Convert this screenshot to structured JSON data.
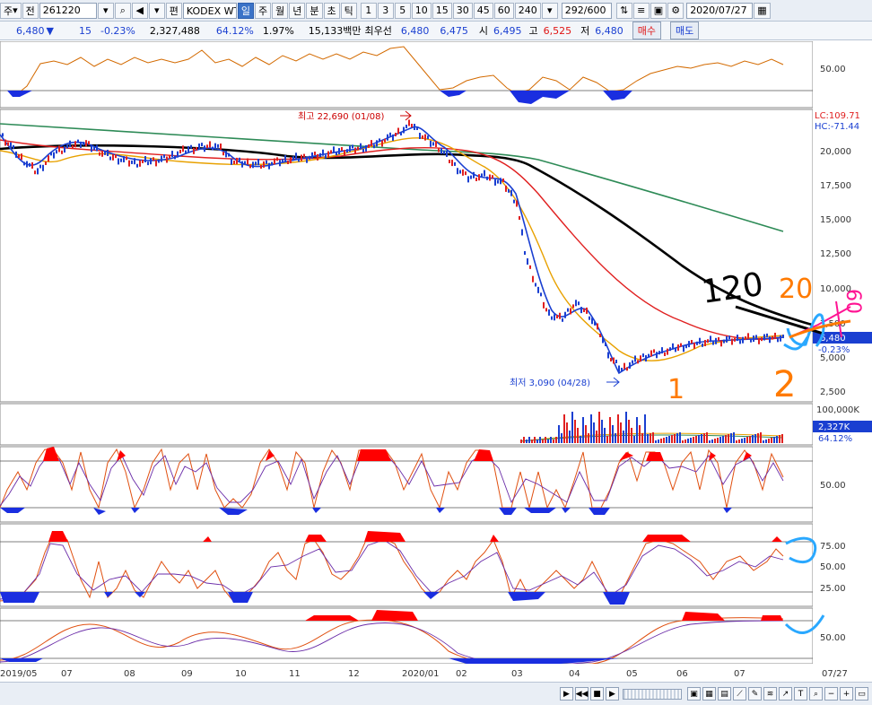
{
  "toolbar": {
    "market": "주",
    "type_label": "전",
    "code": "261220",
    "name": "KODEX WTI원",
    "prefix": "편",
    "periods": [
      "일",
      "주",
      "월",
      "년",
      "분",
      "초",
      "틱"
    ],
    "selected_period": "일",
    "intervals": [
      "1",
      "3",
      "5",
      "10",
      "15",
      "30",
      "45",
      "60",
      "240"
    ],
    "count": "292",
    "count_total": "/600",
    "date": "2020/07/27"
  },
  "quote": {
    "price": "6,480",
    "arrow": "▼",
    "change": "15",
    "change_pct": "-0.23%",
    "volume": "2,327,488",
    "vol_ratio": "64.12%",
    "turnover_pct": "1.97%",
    "amount": "15,133백만",
    "best_label": "최우선",
    "best_ask": "6,480",
    "best_bid": "6,475",
    "open_label": "시",
    "open": "6,495",
    "high_label": "고",
    "high": "6,525",
    "low_label": "저",
    "low": "6,480",
    "buy_label": "매수",
    "sell_label": "매도"
  },
  "chart": {
    "pane1_axis": [
      "50.00"
    ],
    "price_axis": [
      "20,000",
      "17,500",
      "15,000",
      "12,500",
      "10,000",
      "7,500",
      "5,000",
      "2,500"
    ],
    "lc_label": "LC:109.71",
    "hc_label": "HC:-71.44",
    "current_price_tag": "6,480",
    "current_change_tag": "-0.23%",
    "high_note": "최고 22,690 (01/08)",
    "low_note": "최저 3,090 (04/28)",
    "volume_axis": "100,000K",
    "volume_tag": "2,327K",
    "volume_pct_tag": "64.12%",
    "osc1_axis": [
      "50.00"
    ],
    "osc2_axis": [
      "75.00",
      "50.00",
      "25.00"
    ],
    "osc3_axis": [
      "50.00"
    ],
    "x_labels": [
      "2019/05",
      "07",
      "08",
      "09",
      "10",
      "11",
      "12",
      "2020/01",
      "02",
      "03",
      "04",
      "05",
      "06",
      "07"
    ],
    "x_right_label": "07/27",
    "handwriting": [
      "120",
      "20",
      "60",
      "1",
      "2"
    ],
    "colors": {
      "ma5": "#1a3fd1",
      "ma20": "#e8a100",
      "ma60": "#e02020",
      "ma120": "#000000",
      "ma240": "#2e8b57"
    }
  }
}
